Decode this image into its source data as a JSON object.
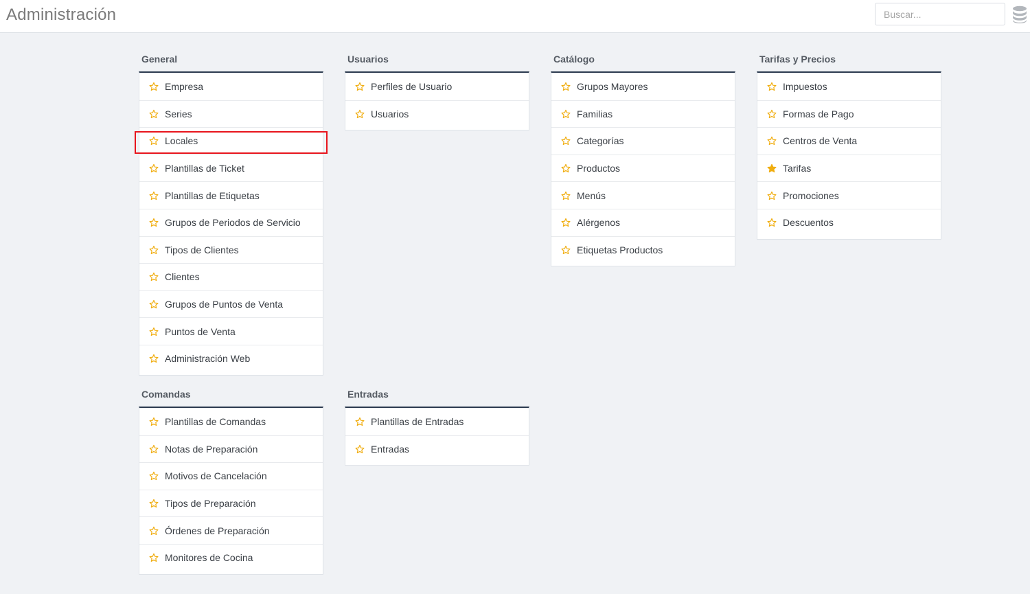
{
  "header": {
    "title": "Administración",
    "search_placeholder": "Buscar...",
    "search_value": "",
    "db_icon": "database-icon"
  },
  "colors": {
    "accent_border": "#2b3a4f",
    "star": "#f0ad0f",
    "highlight": "#e8141c"
  },
  "sections": {
    "general": {
      "title": "General",
      "items": [
        {
          "label": "Empresa",
          "starred": false
        },
        {
          "label": "Series",
          "starred": false
        },
        {
          "label": "Locales",
          "starred": false
        },
        {
          "label": "Plantillas de Ticket",
          "starred": false
        },
        {
          "label": "Plantillas de Etiquetas",
          "starred": false
        },
        {
          "label": "Grupos de Periodos de Servicio",
          "starred": false
        },
        {
          "label": "Tipos de Clientes",
          "starred": false
        },
        {
          "label": "Clientes",
          "starred": false
        },
        {
          "label": "Grupos de Puntos de Venta",
          "starred": false
        },
        {
          "label": "Puntos de Venta",
          "starred": false
        },
        {
          "label": "Administración Web",
          "starred": false
        }
      ]
    },
    "usuarios": {
      "title": "Usuarios",
      "items": [
        {
          "label": "Perfiles de Usuario",
          "starred": false
        },
        {
          "label": "Usuarios",
          "starred": false
        }
      ]
    },
    "catalogo": {
      "title": "Catálogo",
      "items": [
        {
          "label": "Grupos Mayores",
          "starred": false
        },
        {
          "label": "Familias",
          "starred": false
        },
        {
          "label": "Categorías",
          "starred": false
        },
        {
          "label": "Productos",
          "starred": false
        },
        {
          "label": "Menús",
          "starred": false
        },
        {
          "label": "Alérgenos",
          "starred": false
        },
        {
          "label": "Etiquetas Productos",
          "starred": false
        }
      ]
    },
    "tarifas": {
      "title": "Tarifas y Precios",
      "items": [
        {
          "label": "Impuestos",
          "starred": false
        },
        {
          "label": "Formas de Pago",
          "starred": false
        },
        {
          "label": "Centros de Venta",
          "starred": false
        },
        {
          "label": "Tarifas",
          "starred": true
        },
        {
          "label": "Promociones",
          "starred": false
        },
        {
          "label": "Descuentos",
          "starred": false
        }
      ]
    },
    "comandas": {
      "title": "Comandas",
      "items": [
        {
          "label": "Plantillas de Comandas",
          "starred": false
        },
        {
          "label": "Notas de Preparación",
          "starred": false
        },
        {
          "label": "Motivos de Cancelación",
          "starred": false
        },
        {
          "label": "Tipos de Preparación",
          "starred": false
        },
        {
          "label": "Órdenes de Preparación",
          "starred": false
        },
        {
          "label": "Monitores de Cocina",
          "starred": false
        }
      ]
    },
    "entradas": {
      "title": "Entradas",
      "items": [
        {
          "label": "Plantillas de Entradas",
          "starred": false
        },
        {
          "label": "Entradas",
          "starred": false
        }
      ]
    }
  }
}
